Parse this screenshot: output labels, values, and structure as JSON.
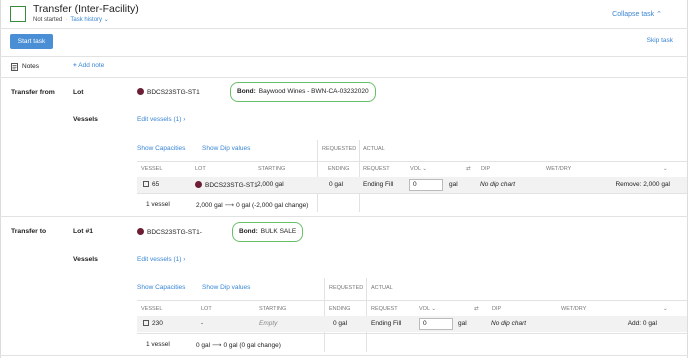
{
  "header": {
    "title": "Transfer (Inter-Facility)",
    "status": "Not started",
    "task_history": "Task history",
    "collapse": "Collapse task",
    "start_task": "Start task",
    "skip_task": "Skip task"
  },
  "notes": {
    "label": "Notes",
    "add_note": "Add note"
  },
  "transfer_from": {
    "label": "Transfer from",
    "lot_label": "Lot",
    "lot_code": "BDCS23STG-ST1",
    "bond_label": "Bond:",
    "bond_value": "Baywood Wines - BWN-CA-03232020",
    "vessels_label": "Vessels",
    "edit_vessels": "Edit vessels (1)",
    "show_capacities": "Show Capacities",
    "show_dip": "Show Dip values",
    "col_requested": "REQUESTED",
    "col_actual": "ACTUAL",
    "columns": [
      "VESSEL",
      "LOT",
      "STARTING",
      "ENDING",
      "REQUEST",
      "VOL",
      "DIP",
      "WET/DRY"
    ],
    "row": {
      "vessel": "65",
      "lot": "BDCS23STG-ST1",
      "starting": "2,000 gal",
      "ending": "0 gal",
      "request": "Ending Fill",
      "vol": "0",
      "vol_unit": "gal",
      "dip": "No dip chart",
      "result": "Remove: 2,000 gal"
    },
    "summary_count": "1 vessel",
    "summary_from": "2,000 gal",
    "summary_to": "0 gal (-2,000 gal change)"
  },
  "transfer_to": {
    "label": "Transfer to",
    "lot_label": "Lot #1",
    "lot_code": "BDCS23STG-ST1-",
    "bond_label": "Bond:",
    "bond_value": "BULK SALE",
    "vessels_label": "Vessels",
    "edit_vessels": "Edit vessels (1)",
    "show_capacities": "Show Capacities",
    "show_dip": "Show Dip values",
    "col_requested": "REQUESTED",
    "col_actual": "ACTUAL",
    "columns": [
      "VESSEL",
      "LOT",
      "STARTING",
      "ENDING",
      "REQUEST",
      "VOL",
      "DIP",
      "WET/DRY"
    ],
    "row": {
      "vessel": "230",
      "lot": "-",
      "starting": "Empty",
      "ending": "0 gal",
      "request": "Ending Fill",
      "vol": "0",
      "vol_unit": "gal",
      "dip": "No dip chart",
      "result": "Add: 0 gal"
    },
    "summary_count": "1 vessel",
    "summary_from": "0 gal",
    "summary_to": "0 gal (0 gal change)"
  },
  "colors": {
    "accent": "#3a86d4",
    "bond_outline": "#6abf69",
    "lot_dot": "#6b1e34"
  }
}
